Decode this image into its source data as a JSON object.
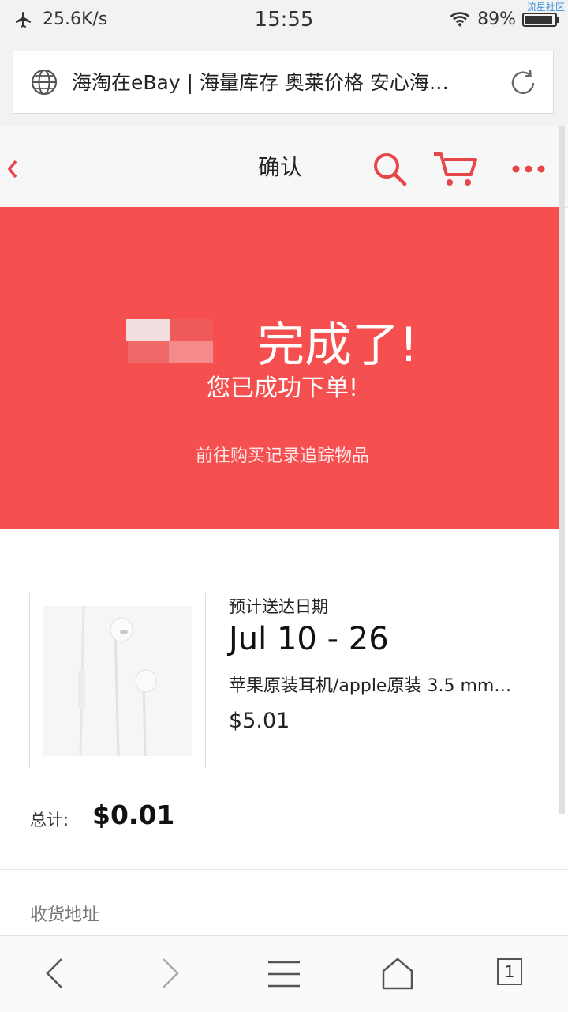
{
  "status_bar": {
    "speed": "25.6K/s",
    "time": "15:55",
    "battery": "89%",
    "watermark": "流星社区"
  },
  "browser": {
    "page_title": "海淘在eBay | 海量库存 奥莱价格 安心海…"
  },
  "header": {
    "title": "确认"
  },
  "banner": {
    "done_text": "完成了!",
    "success_text": "您已成功下单!",
    "track_link": "前往购买记录追踪物品"
  },
  "order": {
    "eta_label": "预计送达日期",
    "eta": "Jul 10 - 26",
    "product_name": "苹果原装耳机/apple原装 3.5 mm…",
    "price": "$5.01",
    "total_label": "总计:",
    "total_value": "$0.01"
  },
  "shipping": {
    "label": "收货地址"
  },
  "nav": {
    "tab_count": "1"
  },
  "colors": {
    "accent": "#f54f4f",
    "icon_red": "#e8474a"
  }
}
